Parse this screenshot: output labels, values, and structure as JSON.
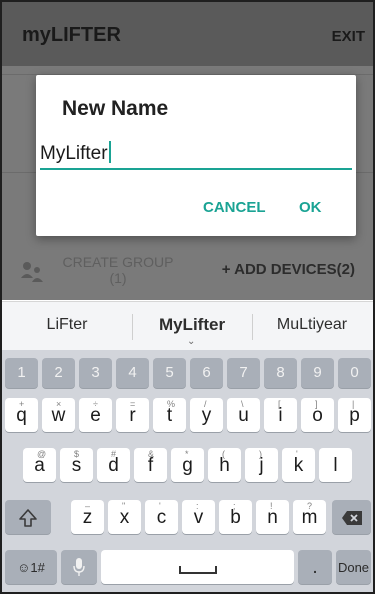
{
  "app": {
    "title": "myLIFTER",
    "exit_label": "EXIT",
    "create_group_line1": "CREATE GROUP",
    "create_group_line2": "(1)",
    "add_devices_label": "+ ADD DEVICES(2)"
  },
  "dialog": {
    "title": "New Name",
    "input_value": "MyLifter",
    "cancel_label": "CANCEL",
    "ok_label": "OK"
  },
  "keyboard": {
    "suggestions": [
      "LiFter",
      "MyLifter",
      "MuLtiyear"
    ],
    "number_row": [
      "1",
      "2",
      "3",
      "4",
      "5",
      "6",
      "7",
      "8",
      "9",
      "0"
    ],
    "row1": [
      "q",
      "w",
      "e",
      "r",
      "t",
      "y",
      "u",
      "i",
      "o",
      "p"
    ],
    "row1_sup": [
      "+",
      "×",
      "÷",
      "=",
      "%",
      "/",
      "\\",
      "[",
      "]",
      "|"
    ],
    "row2": [
      "a",
      "s",
      "d",
      "f",
      "g",
      "h",
      "j",
      "k",
      "l"
    ],
    "row2_sup": [
      "@",
      "$",
      "#",
      "&",
      "*",
      "(",
      ")",
      "'",
      ""
    ],
    "row3": [
      "z",
      "x",
      "c",
      "v",
      "b",
      "n",
      "m"
    ],
    "row3_sup": [
      "–",
      "\"",
      "'",
      ":",
      ";",
      "!",
      "?"
    ],
    "symbols_label": "☺1#",
    "done_label": "Done",
    "period_label": "."
  },
  "colors": {
    "accent": "#1aa394",
    "scrim": "#5a5a5a",
    "keyboard_bg": "#d2d5db"
  }
}
